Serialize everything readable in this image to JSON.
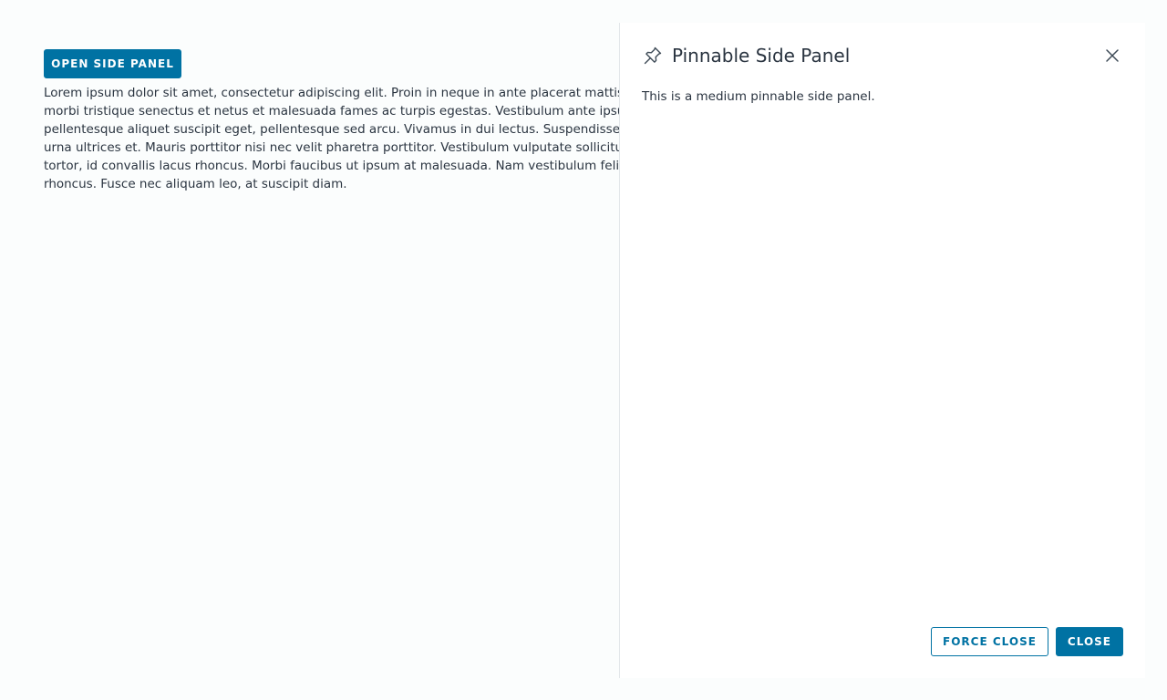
{
  "main": {
    "open_button_label": "OPEN SIDE PANEL",
    "lorem_text": "Lorem ipsum dolor sit amet, consectetur adipiscing elit. Proin in neque in ante placerat mattis id sed quam. Proin rhoncus lacus et tristique pharetra. Pellentesque habitant morbi tristique senectus et netus et malesuada fames ac turpis egestas. Vestibulum ante ipsum primis in faucibus orci luctus et ultrices posuere cubilia curae; Sed pellentesque aliquet suscipit eget, pellentesque sed arcu. Vivamus in dui lectus. Suspendisse cursus est ac nisl imperdiet viverra. Aenean sagittis nibh lacus, in eleifend urna ultrices et. Mauris porttitor nisi nec velit pharetra porttitor. Vestibulum vulputate sollicitudin dolor ut tincidunt. Phasellus vitae blandit felis. Nullam posuere ipsum tortor, id convallis lacus rhoncus. Morbi faucibus ut ipsum at malesuada. Nam vestibulum felis sit amet metus finibus hendrerit. Fusce faucibus odio eget ex vulputate rhoncus. Fusce nec aliquam leo, at suscipit diam."
  },
  "panel": {
    "pin_icon": "pin-icon",
    "title": "Pinnable Side Panel",
    "close_icon": "close-icon",
    "body_text": "This is a medium pinnable side panel.",
    "force_close_label": "FORCE CLOSE",
    "close_label": "CLOSE"
  },
  "colors": {
    "primary": "#0072a3",
    "text": "#2a3440"
  }
}
